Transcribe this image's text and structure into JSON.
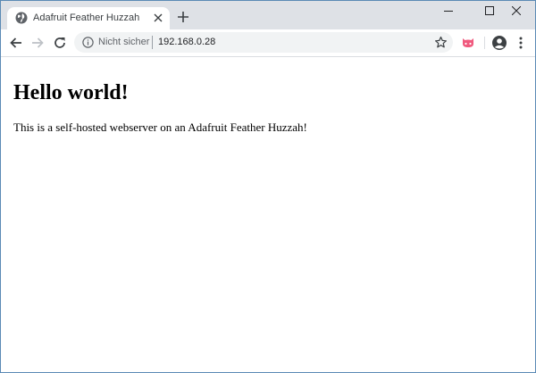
{
  "tab": {
    "title": "Adafruit Feather Huzzah",
    "favicon": "globe-icon"
  },
  "toolbar": {
    "security_text": "Nicht sicher",
    "url": "192.168.0.28"
  },
  "page": {
    "heading": "Hello world!",
    "paragraph": "This is a self-hosted webserver on an Adafruit Feather Huzzah!"
  },
  "icons": {
    "back": "arrow-left-icon",
    "forward": "arrow-right-icon",
    "reload": "reload-icon",
    "info": "info-icon",
    "bookmark": "star-icon",
    "extension": "octocat-icon",
    "profile": "account-icon",
    "menu": "kebab-menu-icon"
  },
  "colors": {
    "tabstrip": "#dee1e6",
    "omnibox": "#f1f3f4",
    "extension_accent": "#f05a7e",
    "window_border": "#5b8ab5"
  }
}
